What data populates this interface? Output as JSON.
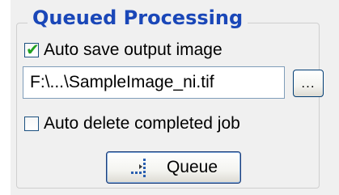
{
  "group": {
    "title": "Queued Processing"
  },
  "auto_save": {
    "label": "Auto save output image",
    "checked": true
  },
  "output_path": {
    "value": "F:\\...\\SampleImage_ni.tif"
  },
  "browse_button": {
    "label": "..."
  },
  "auto_delete": {
    "label": "Auto delete completed job",
    "checked": false
  },
  "queue_button": {
    "label": "Queue",
    "icon": "queue-icon"
  },
  "colors": {
    "title": "#1a47b8",
    "check": "#21a121",
    "panel_bg": "#f0f0f0"
  }
}
